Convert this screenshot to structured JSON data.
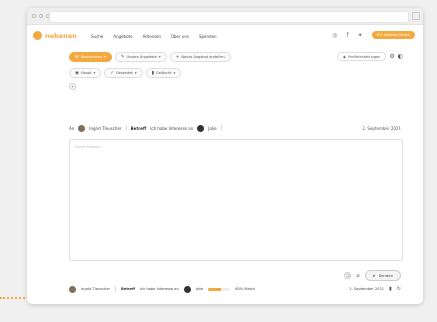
{
  "nav": {
    "brand": "nebenan",
    "menu": [
      "Suche",
      "Angebote",
      "Adressen",
      "Über uns",
      "Spenden"
    ],
    "cta": "Für Anbieter/innen"
  },
  "filters": {
    "row1": [
      {
        "label": "Nachrichten",
        "icon": "✉",
        "active": true
      },
      {
        "label": "Unsere Angebote",
        "icon": "✎",
        "active": false
      },
      {
        "label": "Neues Angebot erstellen",
        "icon": "+",
        "active": false
      }
    ],
    "row1_right": {
      "label": "Profileinstellungen",
      "icon": "⚙"
    },
    "row2": [
      {
        "label": "Haupt",
        "icon": "◉"
      },
      {
        "label": "Gesendet",
        "icon": "✓"
      },
      {
        "label": "Gelöscht",
        "icon": "▮"
      }
    ]
  },
  "compose": {
    "to_label": "An",
    "recipient": "Ingrid Tleuscher",
    "subject_label": "Betreff",
    "subject": "Ich habe Interesse an",
    "item": "Jolie",
    "date": "2. September 2021",
    "placeholder": "Deine Antwort",
    "send_label": "Senden"
  },
  "footer": {
    "recipient": "Ingrid Tleuscher",
    "subject_label": "Betreff",
    "subject": "Ich habe Interesse an",
    "item": "Jolie",
    "match_percent": 60,
    "match_text": "60% Match",
    "date": "2. September 2021"
  },
  "colors": {
    "accent": "#f2a940"
  }
}
